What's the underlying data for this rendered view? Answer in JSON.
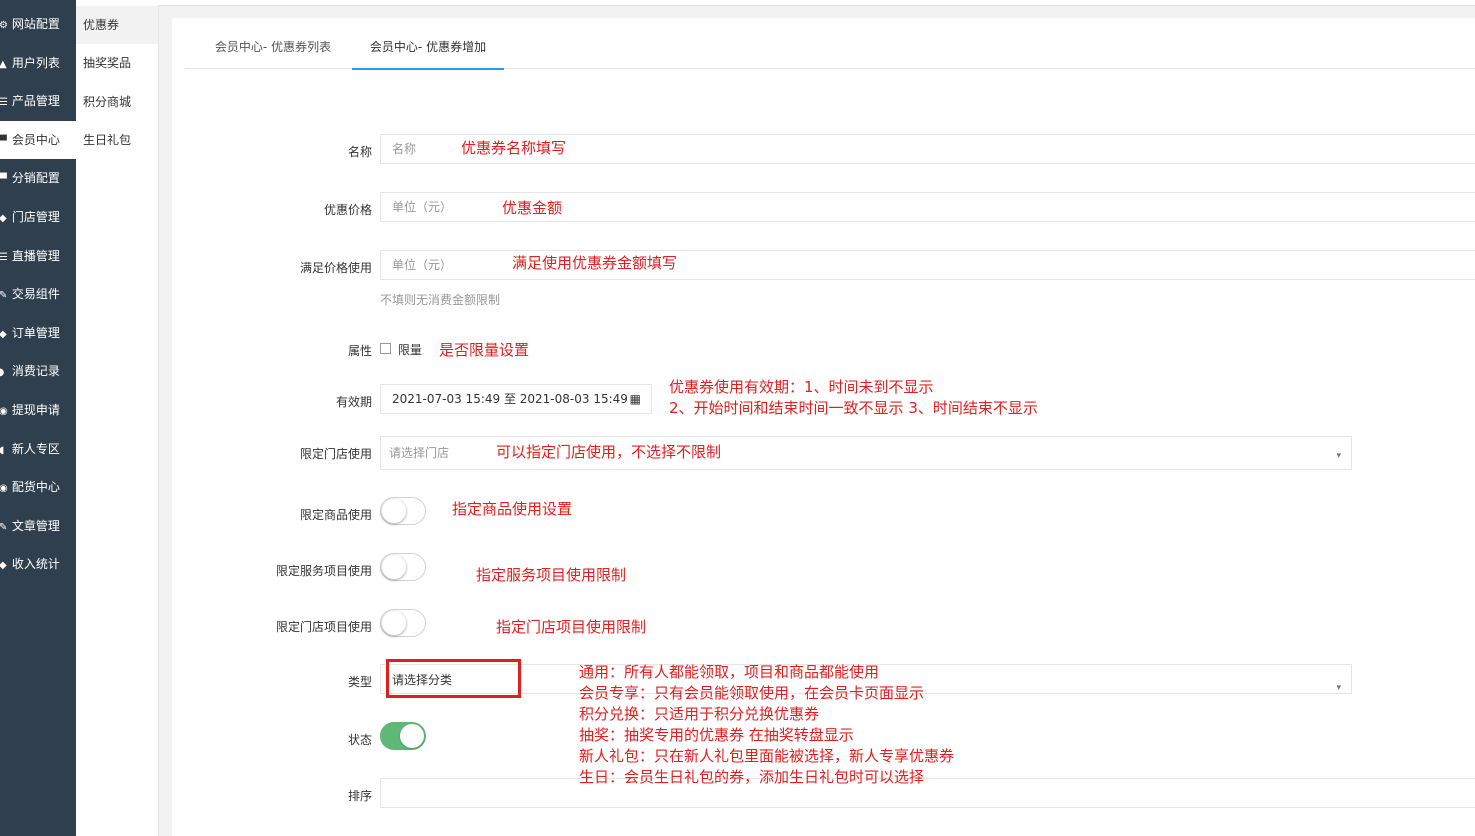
{
  "sidebar": {
    "items": [
      {
        "label": "网站配置",
        "icon": "settings-icon",
        "glyph": "⚙"
      },
      {
        "label": "用户列表",
        "icon": "user-icon",
        "glyph": "▲"
      },
      {
        "label": "产品管理",
        "icon": "list-icon",
        "glyph": "☰"
      },
      {
        "label": "会员中心",
        "icon": "member-icon",
        "glyph": "▀"
      },
      {
        "label": "分销配置",
        "icon": "distribution-icon",
        "glyph": "▀"
      },
      {
        "label": "门店管理",
        "icon": "store-icon",
        "glyph": "◆"
      },
      {
        "label": "直播管理",
        "icon": "live-icon",
        "glyph": "☰"
      },
      {
        "label": "交易组件",
        "icon": "component-icon",
        "glyph": "✎"
      },
      {
        "label": "订单管理",
        "icon": "order-icon",
        "glyph": "◆"
      },
      {
        "label": "消费记录",
        "icon": "record-icon",
        "glyph": "◗"
      },
      {
        "label": "提现申请",
        "icon": "withdraw-icon",
        "glyph": "◉"
      },
      {
        "label": "新人专区",
        "icon": "newbie-icon",
        "glyph": "◖"
      },
      {
        "label": "配货中心",
        "icon": "distribution-center-icon",
        "glyph": "◉"
      },
      {
        "label": "文章管理",
        "icon": "article-icon",
        "glyph": "✎"
      },
      {
        "label": "收入统计",
        "icon": "stats-icon",
        "glyph": "◆"
      }
    ]
  },
  "subnav": {
    "items": [
      "优惠券",
      "抽奖奖品",
      "积分商城",
      "生日礼包"
    ]
  },
  "tabs": [
    "会员中心- 优惠券列表",
    "会员中心- 优惠券增加"
  ],
  "form": {
    "name_label": "名称",
    "name_placeholder": "名称",
    "price_label": "优惠价格",
    "price_placeholder": "单位（元）",
    "min_label": "满足价格使用",
    "min_placeholder": "单位（元）",
    "min_hint": "不填则无消费金额限制",
    "attr_label": "属性",
    "attr_option": "限量",
    "validity_label": "有效期",
    "validity_value": "2021-07-03 15:49 至 2021-08-03 15:49",
    "store_label": "限定门店使用",
    "store_placeholder": "请选择门店",
    "goods_label": "限定商品使用",
    "service_label": "限定服务项目使用",
    "store_project_label": "限定门店项目使用",
    "type_label": "类型",
    "type_placeholder": "请选择分类",
    "status_label": "状态",
    "sort_label": "排序"
  },
  "switches": {
    "goods": false,
    "service": false,
    "store_project": false,
    "status": true
  },
  "annotations": {
    "name": "优惠券名称填写",
    "price": "优惠金额",
    "min": "满足使用优惠券金额填写",
    "attr": "是否限量设置",
    "validity_1": "优惠券使用有效期：1、时间未到不显示",
    "validity_2": "2、开始时间和结束时间一致不显示   3、时间结束不显示",
    "store": "可以指定门店使用，不选择不限制",
    "goods": "指定商品使用设置",
    "service": "指定服务项目使用限制",
    "store_project": "指定门店项目使用限制",
    "type_lines": [
      "通用：所有人都能领取，项目和商品都能使用",
      "会员专享：只有会员能领取使用，在会员卡页面显示",
      "积分兑换：只适用于积分兑换优惠券",
      "抽奖：抽奖专用的优惠券  在抽奖转盘显示",
      "新人礼包：只在新人礼包里面能被选择，新人专享优惠券",
      "生日：会员生日礼包的券，添加生日礼包时可以选择"
    ]
  },
  "colors": {
    "annotation": "#e02020",
    "sidebar": "#2f3f4e",
    "tab_active": "#1e9fff",
    "switch_on": "#5fb878"
  }
}
